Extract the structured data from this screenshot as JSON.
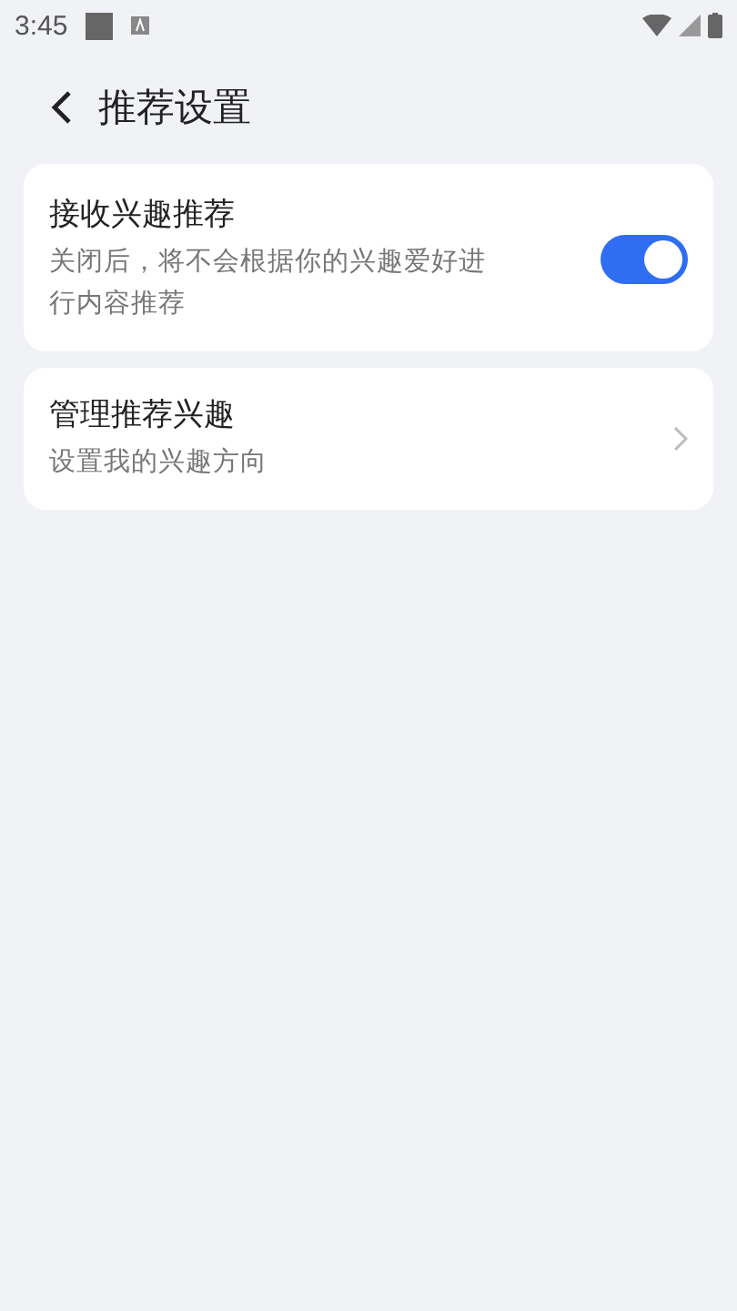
{
  "status_bar": {
    "time": "3:45"
  },
  "header": {
    "title": "推荐设置"
  },
  "items": [
    {
      "kind": "toggle",
      "title": "接收兴趣推荐",
      "subtitle": "关闭后，将不会根据你的兴趣爱好进行内容推荐",
      "on": true
    },
    {
      "kind": "link",
      "title": "管理推荐兴趣",
      "subtitle": "设置我的兴趣方向"
    }
  ]
}
